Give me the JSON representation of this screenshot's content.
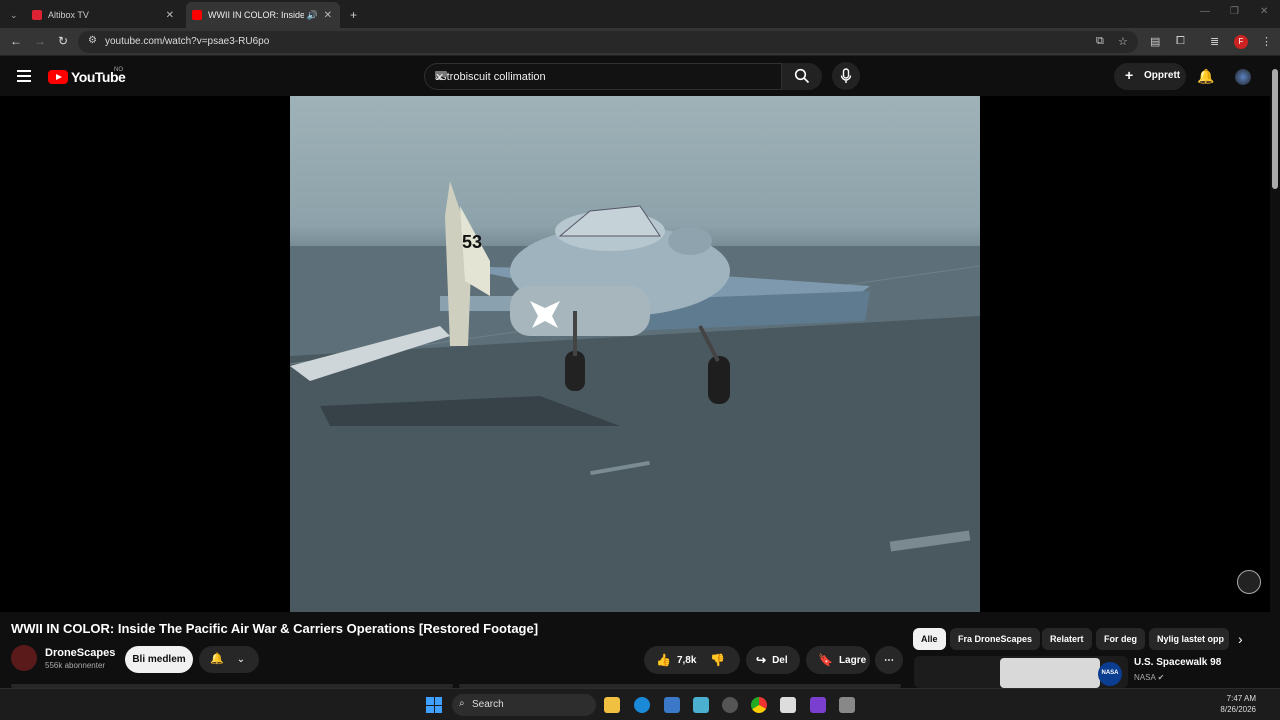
{
  "browser": {
    "tabs": [
      {
        "title": "Altibox TV"
      },
      {
        "title": "WWII IN COLOR: Inside The"
      }
    ],
    "url": "youtube.com/watch?v=psae3-RU6po",
    "new_tab": "+"
  },
  "youtube": {
    "logo_text": "YouTube",
    "region": "NO",
    "search_value": "astrobiscuit collimation",
    "create_label": "Opprett"
  },
  "video": {
    "title": "WWII IN COLOR: Inside The Pacific Air War & Carriers Operations [Restored Footage]",
    "channel": "DroneScapes",
    "subscribers": "556k abonnenter",
    "join_label": "Bli medlem",
    "likes": "7,8k",
    "share_label": "Del",
    "save_label": "Lagre"
  },
  "chips": [
    {
      "label": "Alle",
      "active": true
    },
    {
      "label": "Fra DroneScapes"
    },
    {
      "label": "Relatert"
    },
    {
      "label": "For deg"
    },
    {
      "label": "Nylig lastet opp"
    }
  ],
  "recommendation": {
    "title": "U.S. Spacewalk 98",
    "channel": "NASA"
  },
  "taskbar": {
    "search_label": "Search",
    "time": "7:47 AM",
    "date": "8/26/2026"
  },
  "colors": {
    "accent": "#ff0000",
    "background": "#0f0f0f"
  }
}
